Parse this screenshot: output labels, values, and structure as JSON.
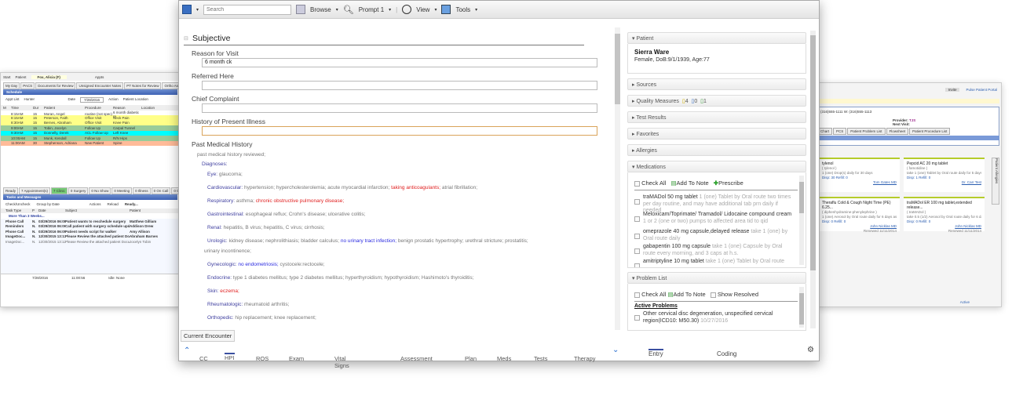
{
  "left_window": {
    "patient_label": "Patient",
    "patient": "Fox, Alicia (F)",
    "start": "Start",
    "appts": "Appts",
    "tabs": [
      "My Day",
      "PACS",
      "Documents for Review",
      "Unsigned Encounter Notes",
      "PT Notes for Review",
      "Ortho Associations",
      "MU"
    ],
    "schedule_title": "Schedule",
    "appt_list_label": "Appt List",
    "appt_list": "Hunter",
    "date_label": "Date",
    "date": "7/28/2016",
    "action": "Action",
    "patient_location": "Patient Location",
    "columns": [
      "M",
      "Time",
      "Dur",
      "Patient",
      "Procedure",
      "Reason",
      "Location"
    ],
    "rows": [
      {
        "time": "8:15AM",
        "dur": "15",
        "patient": "Moran, Angel",
        "proc": "routine (not spec)",
        "reason": "6 month diabetic re",
        "color": "#ffffff"
      },
      {
        "time": "8:15AM",
        "dur": "15",
        "patient": "Peterson, Faith",
        "proc": "Office Visit",
        "reason": "Neck Pain",
        "color": "#ffff88"
      },
      {
        "time": "8:30AM",
        "dur": "15",
        "patient": "Bernes, Abraham",
        "proc": "Office Visit",
        "reason": "Knee Pain",
        "color": "#ffff88"
      },
      {
        "time": "9:00AM",
        "dur": "15",
        "patient": "Tobin, Jocelyn",
        "proc": "Follow Up",
        "reason": "Carpal Tunnel",
        "color": "#99cc99"
      },
      {
        "time": "9:30AM",
        "dur": "15",
        "patient": "Donnelly, Derek",
        "proc": "ACL Follow Up",
        "reason": "Left Knee",
        "color": "#00ffff"
      },
      {
        "time": "10:00AM",
        "dur": "15",
        "patient": "Munk, Kendall",
        "proc": "Follow Up",
        "reason": "R/N Hips",
        "color": "#99cc99"
      },
      {
        "time": "11:00AM",
        "dur": "30",
        "patient": "Stephenson, Adriana",
        "proc": "New Patient",
        "reason": "Spine",
        "color": "#ffbb99"
      }
    ],
    "status_tabs": [
      "Ready",
      "7 Appointment(s)",
      "7 Clinic",
      "0 Surgery",
      "0 No Show",
      "0 Meeting",
      "0 Illness",
      "0 On Call",
      "0 Out of Office"
    ],
    "tasks_title": "Tasks and Messages",
    "check_uncheck": "Check/Uncheck",
    "group_by": "Group by Date",
    "actions": "Actions",
    "reload": "Reload",
    "ready": "Ready...",
    "task_columns": [
      "Task Type",
      "P",
      "Date",
      "Subject",
      "Patient"
    ],
    "more_than": "More Than 3 Weeks...",
    "tasks": [
      {
        "type": "Phone Call",
        "p": "N.",
        "date": "03/29/2016 06:08",
        "subject": "Patient wants to reschedule surgery",
        "patient": "Matthew Gilliam"
      },
      {
        "type": "Reminders",
        "p": "N.",
        "date": "03/29/2016 06:06",
        "subject": "Call patient with surgery schedule update",
        "patient": "Addison Drew"
      },
      {
        "type": "Phone Call",
        "p": "N.",
        "date": "03/29/2016 06:05",
        "subject": "Patient needs script for walker",
        "patient": "Amy Allison"
      },
      {
        "type": "ImageDoc...",
        "p": "N.",
        "date": "12/30/2015 13:13",
        "subject": "Please Review the attached patient Document",
        "patient": "Abraham Barnes"
      },
      {
        "type": "ImageDoc...",
        "p": "N.",
        "date": "12/30/2015 13:12",
        "subject": "Please Review the attached patient Document",
        "patient": "Jocelyn Tobin"
      }
    ],
    "footer": [
      "7/28/2016",
      "11:00:56",
      "Idle: None"
    ]
  },
  "right_window": {
    "invite": "Invite",
    "portal": "Pulse Patient Portal",
    "phone": "(316)555-1111  W: (316)555-1113",
    "provider_label": "Provider:",
    "provider": "TJS",
    "next_visit_label": "Next Visit:",
    "tabs": [
      "Chart",
      "PCS",
      "Patient Problem List",
      "Flowsheet",
      "Patient Procedure List"
    ],
    "side_tab": "Patient Allergies",
    "cards": [
      {
        "name": "tylenol",
        "generic": "( tylenol )",
        "sig": "1 (one) Drop(s) daily for 30 days",
        "disp": "Disp: 30  Refill: 0",
        "by": "Tom Gates MD"
      },
      {
        "name": "Pepcid AC 20 mg tablet",
        "generic": "( famotidine )",
        "sig": "take 1 (one) Tablet by Oral route daily for 5 days",
        "disp": "Disp: 1  Refill: 0",
        "by": "Dr. Carr Test"
      },
      {
        "name": "Theraflu Cold & Cough Night Time (PE) 6.25...",
        "generic": "( diphenhydramine-phenylephrine )",
        "sig": "1 (one) Aerosol by Oral route daily for 6 days  as needed",
        "disp": "Disp: 0  Refill: 0",
        "by": "John Nicklas MD",
        "renewed": "Renewed 11/11/2014"
      },
      {
        "name": "traMADol ER 100 mg tablet,extended release...",
        "generic": "( traMADol )",
        "sig": "take 0.5 (1/2) Aerosol by Oral route daily for 6 days  as...",
        "disp": "Disp: 0  Refill: 0",
        "by": "John Nicklas MD",
        "renewed": "Renewed 11/11/2014"
      }
    ],
    "active": "Active"
  },
  "toolbar": {
    "search_placeholder": "Search",
    "browse": "Browse",
    "prompt": "Prompt 1",
    "view": "View",
    "tools": "Tools"
  },
  "note": {
    "section": "Subjective",
    "fields": [
      {
        "label": "Reason for Visit",
        "value": "6 month ck"
      },
      {
        "label": "Referred Here",
        "value": ""
      },
      {
        "label": "Chief Complaint",
        "value": ""
      },
      {
        "label": "History of Present Illness",
        "value": ""
      }
    ],
    "pmh_label": "Past Medical History",
    "pmh_reviewed": "past medical history reviewed;",
    "diagnoses_label": "Diagnoses:",
    "diagnoses": [
      {
        "label": "Eye:",
        "items": [
          {
            "t": "glaucoma;",
            "c": "n"
          }
        ]
      },
      {
        "label": "Cardiovascular:",
        "items": [
          {
            "t": "hypertension;",
            "c": "n"
          },
          {
            "t": "hypercholesterolemia;",
            "c": "n"
          },
          {
            "t": "acute myocardial infarction;",
            "c": "n"
          },
          {
            "t": "taking anticoagulants;",
            "c": "r"
          },
          {
            "t": "atrial fibrillation;",
            "c": "n"
          }
        ]
      },
      {
        "label": "Respiratory:",
        "items": [
          {
            "t": "asthma;",
            "c": "n"
          },
          {
            "t": "chronic obstructive pulmonary disease;",
            "c": "r"
          }
        ]
      },
      {
        "label": "Gastrointestinal:",
        "items": [
          {
            "t": "esophageal reflux;",
            "c": "n"
          },
          {
            "t": "Crohn's disease;",
            "c": "n"
          },
          {
            "t": "ulcerative colitis;",
            "c": "n"
          }
        ]
      },
      {
        "label": "Renal:",
        "items": [
          {
            "t": "hepatitis, B virus;",
            "c": "n"
          },
          {
            "t": "hepatitis, C virus;",
            "c": "n"
          },
          {
            "t": "cirrhosis;",
            "c": "n"
          }
        ]
      },
      {
        "label": "Urologic:",
        "items": [
          {
            "t": "kidney disease;",
            "c": "n"
          },
          {
            "t": "nephrolithiasis;",
            "c": "n"
          },
          {
            "t": "bladder calculus;",
            "c": "n"
          },
          {
            "t": "no urinary tract infection;",
            "c": "b"
          },
          {
            "t": "benign prostatic hypertrophy;",
            "c": "n"
          },
          {
            "t": "urethral stricture;",
            "c": "n"
          },
          {
            "t": "prostatitis;",
            "c": "n"
          }
        ],
        "wrap": "urinary incontinence;"
      },
      {
        "label": "Gynecologic:",
        "items": [
          {
            "t": "no endometriosis;",
            "c": "b"
          },
          {
            "t": "cystocele:rectocele;",
            "c": "n"
          }
        ]
      },
      {
        "label": "Endocrine:",
        "items": [
          {
            "t": "type 1 diabetes mellitus;",
            "c": "n"
          },
          {
            "t": "type 2 diabetes mellitus;",
            "c": "n"
          },
          {
            "t": "hyperthyroidism;",
            "c": "n"
          },
          {
            "t": "hypothyroidism;",
            "c": "n"
          },
          {
            "t": "Hashimoto's thyroiditis;",
            "c": "n"
          }
        ]
      },
      {
        "label": "Skin:",
        "items": [
          {
            "t": "eczema;",
            "c": "r"
          }
        ]
      },
      {
        "label": "Rheumatologic:",
        "items": [
          {
            "t": "rheumatoid arthritis;",
            "c": "n"
          }
        ]
      },
      {
        "label": "Orthopedic:",
        "items": [
          {
            "t": "hip replacement;",
            "c": "n"
          },
          {
            "t": "knee replacement;",
            "c": "n"
          }
        ]
      }
    ],
    "current_encounter": "Current Encounter",
    "nav": [
      "CC",
      "HPI",
      "ROS",
      "Exam",
      "Vital Signs",
      "Assessment",
      "Plan",
      "Meds",
      "Tests",
      "Therapy"
    ]
  },
  "sidebar": {
    "patient_header": "Patient",
    "patient_name": "Sierra Ware",
    "patient_info": "Female, DoB:9/1/1939, Age:77",
    "sources": "Sources",
    "quality_measures": "Quality Measures",
    "qm_counts": [
      "4",
      "0",
      "1"
    ],
    "test_results": "Test Results",
    "favorites": "Favorites",
    "allergies": "Allergies",
    "medications": "Medications",
    "check_all": "Check All",
    "add_to_note": "Add To Note",
    "prescribe": "Prescribe",
    "meds": [
      {
        "name": "traMADol 50 mg tablet",
        "sig": "1 (one) Tablet by Oral route two times per day routine, and may have additional tab prn daily if needed"
      },
      {
        "name": "Meloxicam/Toprimate/ Tramadol/ Lidocaine compound cream",
        "sig": "1 or 2 (one or two) pumps to affected area tid to qid"
      },
      {
        "name": "omeprazole 40 mg capsule,delayed release",
        "sig": "take 1 (one) by Oral route daily"
      },
      {
        "name": "gabapentin 100 mg capsule",
        "sig": "take 1 (one) Capsule by Oral route every morning, and 3 caps at h.s."
      },
      {
        "name": "amitriptyline 10 mg tablet",
        "sig": "take 1 (one) Tablet by Oral route"
      }
    ],
    "problem_list": "Problem List",
    "show_resolved": "Show Resolved",
    "active_problems": "Active Problems",
    "problems": [
      {
        "name": "Other cervical disc degeneration, unspecified cervical region(ICD10: M50.30)",
        "date": "10/27/2016"
      }
    ],
    "bottom_tabs": [
      "Entry",
      "Coding"
    ]
  }
}
